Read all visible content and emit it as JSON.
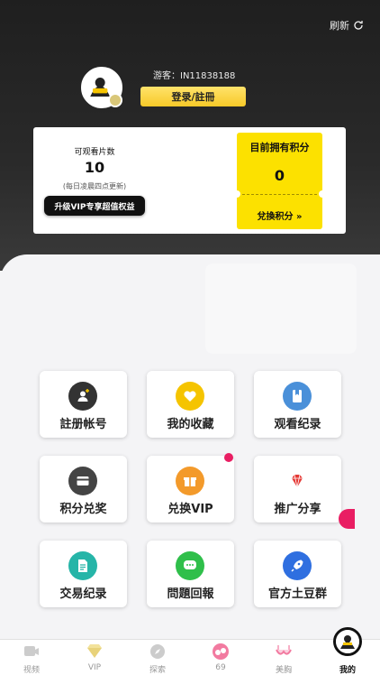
{
  "header": {
    "refresh_label": "刷新",
    "guest_text": "游客：IN11838188",
    "login_button": "登录/註冊"
  },
  "card": {
    "watch_label": "可观看片数",
    "watch_count": "10",
    "watch_note": "(每日凌晨四点更新)",
    "upgrade_button": "升级VIP专享超值权益",
    "points_title": "目前拥有积分",
    "points_value": "0",
    "redeem_button": "兌換积分 »"
  },
  "grid": {
    "items": [
      {
        "label": "註册帐号",
        "icon": "add-user-icon",
        "color": "#333333"
      },
      {
        "label": "我的收藏",
        "icon": "heart-icon",
        "color": "#f5c400"
      },
      {
        "label": "观看纪录",
        "icon": "bookmark-icon",
        "color": "#4a90d9"
      },
      {
        "label": "积分兑奖",
        "icon": "card-icon",
        "color": "#444444"
      },
      {
        "label": "兑换VIP",
        "icon": "gift-icon",
        "color": "#f39a2b"
      },
      {
        "label": "推广分享",
        "icon": "diamond-icon",
        "color": "#e53935"
      },
      {
        "label": "交易纪录",
        "icon": "document-icon",
        "color": "#26b5a8"
      },
      {
        "label": "問題回報",
        "icon": "chat-icon",
        "color": "#2fbf4a"
      },
      {
        "label": "官方土豆群",
        "icon": "rocket-icon",
        "color": "#2f6fe0"
      }
    ]
  },
  "nav": {
    "items": [
      {
        "label": "视频",
        "icon": "video-icon"
      },
      {
        "label": "VIP",
        "icon": "vip-icon"
      },
      {
        "label": "探索",
        "icon": "compass-icon"
      },
      {
        "label": "69",
        "icon": "sixtynine-icon"
      },
      {
        "label": "美胸",
        "icon": "bra-icon"
      },
      {
        "label": "我的",
        "icon": "profile-icon"
      }
    ]
  },
  "colors": {
    "accent_yellow": "#fce100",
    "header_dark": "#1f1f1f"
  }
}
